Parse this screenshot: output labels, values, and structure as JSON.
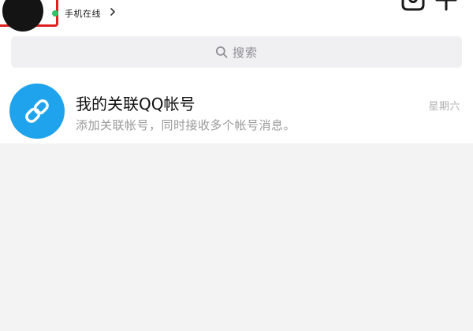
{
  "header": {
    "status_text": "手机在线",
    "online_color": "#2dc36a",
    "highlight_color": "#e02020",
    "icons": [
      "camera-icon",
      "plus-icon"
    ]
  },
  "search": {
    "placeholder": "搜索",
    "icon": "search-icon"
  },
  "chats": [
    {
      "title": "我的关联QQ帐号",
      "subtitle": "添加关联帐号，同时接收多个帐号消息。",
      "time": "星期六",
      "avatar_icon": "link-icon",
      "avatar_color": "#1fa3ec"
    }
  ]
}
